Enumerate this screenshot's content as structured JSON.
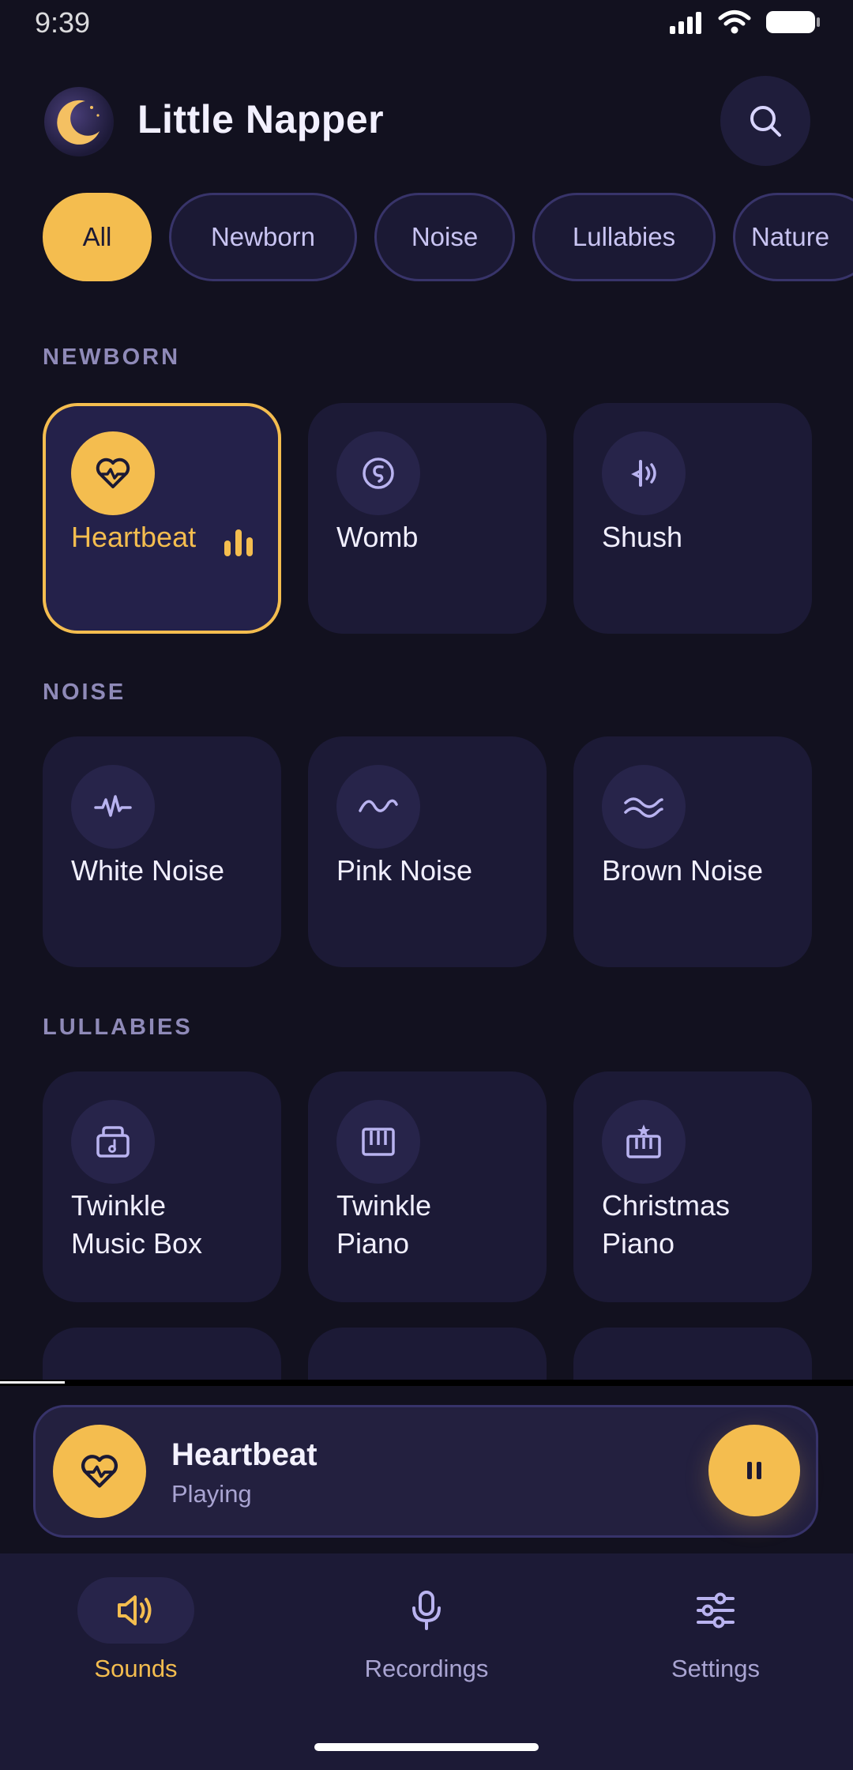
{
  "status_bar": {
    "time": "9:39"
  },
  "header": {
    "title": "Little Napper"
  },
  "chips": [
    "All",
    "Newborn",
    "Noise",
    "Lullabies",
    "Nature"
  ],
  "sections": {
    "newborn": {
      "label": "NEWBORN",
      "items": [
        {
          "label": "Heartbeat",
          "icon": "heart-pulse-icon",
          "selected": true
        },
        {
          "label": "Womb",
          "icon": "womb-icon"
        },
        {
          "label": "Shush",
          "icon": "shush-icon"
        }
      ]
    },
    "noise": {
      "label": "NOISE",
      "items": [
        {
          "label": "White Noise",
          "icon": "pulse-wave-icon"
        },
        {
          "label": "Pink Noise",
          "icon": "sine-wave-icon"
        },
        {
          "label": "Brown Noise",
          "icon": "double-wave-icon"
        }
      ]
    },
    "lullabies": {
      "label": "LULLABIES",
      "items": [
        {
          "label1": "Twinkle",
          "label2": "Music Box",
          "icon": "music-box-icon"
        },
        {
          "label1": "Twinkle",
          "label2": "Piano",
          "icon": "piano-icon"
        },
        {
          "label1": "Christmas",
          "label2": "Piano",
          "icon": "christmas-piano-icon"
        }
      ]
    }
  },
  "now_playing": {
    "title": "Heartbeat",
    "status": "Playing"
  },
  "nav": {
    "sounds": "Sounds",
    "recordings": "Recordings",
    "settings": "Settings"
  },
  "colors": {
    "accent": "#f4bd4f",
    "background": "#12111f",
    "card": "#1c1a36"
  }
}
